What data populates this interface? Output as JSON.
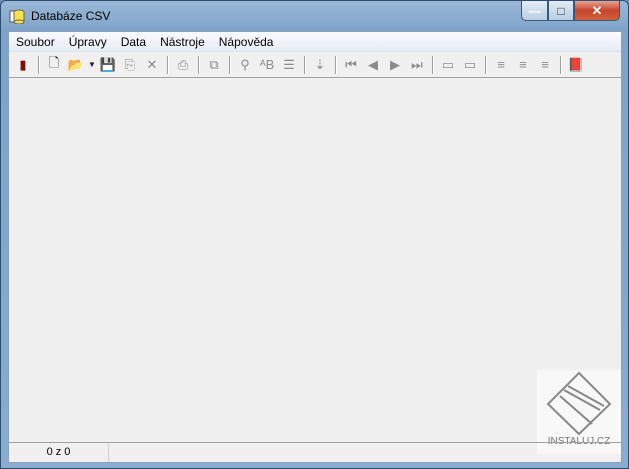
{
  "window": {
    "title": "Databáze CSV",
    "minimize": "—",
    "maximize": "□",
    "close": "✕"
  },
  "menu": [
    "Soubor",
    "Úpravy",
    "Data",
    "Nástroje",
    "Nápověda"
  ],
  "toolbar": [
    {
      "name": "exit-icon",
      "glyph": "▮",
      "on": true,
      "color": "#7a0d0d"
    },
    {
      "sep": true
    },
    {
      "name": "new-file-icon",
      "glyph": "🗋",
      "on": true
    },
    {
      "name": "open-folder-icon",
      "glyph": "📂",
      "on": true,
      "color": "#c8a020"
    },
    {
      "dd": true,
      "glyph": "▼"
    },
    {
      "name": "save-icon",
      "glyph": "💾"
    },
    {
      "name": "save-as-icon",
      "glyph": "⎘"
    },
    {
      "name": "delete-icon",
      "glyph": "✕"
    },
    {
      "sep": true
    },
    {
      "name": "print-icon",
      "glyph": "⎙"
    },
    {
      "sep": true
    },
    {
      "name": "copy-icon",
      "glyph": "⧉"
    },
    {
      "sep": true
    },
    {
      "name": "find-icon",
      "glyph": "⚲"
    },
    {
      "name": "replace-icon",
      "glyph": "ᴬB"
    },
    {
      "name": "goto-icon",
      "glyph": "☰"
    },
    {
      "sep": true
    },
    {
      "name": "sort-az-icon",
      "glyph": "⇣"
    },
    {
      "sep": true
    },
    {
      "name": "first-record-icon",
      "glyph": "⏮"
    },
    {
      "name": "prev-record-icon",
      "glyph": "◀"
    },
    {
      "name": "next-record-icon",
      "glyph": "▶"
    },
    {
      "name": "last-record-icon",
      "glyph": "⏭"
    },
    {
      "sep": true
    },
    {
      "name": "add-row-icon",
      "glyph": "▭"
    },
    {
      "name": "delete-row-icon",
      "glyph": "▭"
    },
    {
      "sep": true
    },
    {
      "name": "add-column-icon",
      "glyph": "≡"
    },
    {
      "name": "insert-column-icon",
      "glyph": "≡"
    },
    {
      "name": "delete-column-icon",
      "glyph": "≡"
    },
    {
      "sep": true
    },
    {
      "name": "help-book-icon",
      "glyph": "📕",
      "on": true,
      "color": "#7a1a7a"
    }
  ],
  "status": {
    "record": "0 z 0"
  },
  "watermark": "INSTALUJ.CZ"
}
